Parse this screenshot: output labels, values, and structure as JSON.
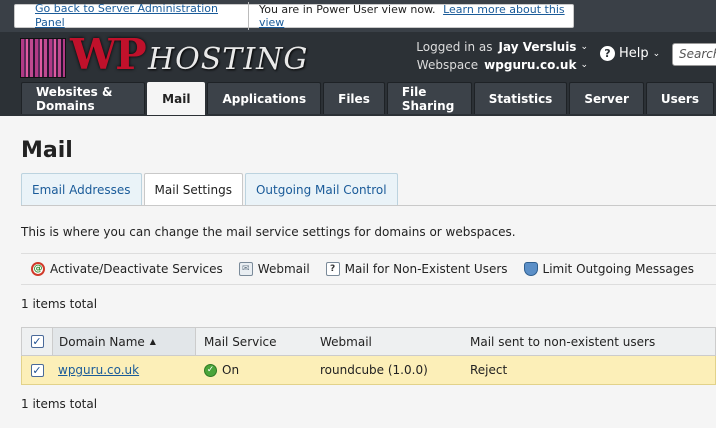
{
  "notice": {
    "back_link": "Go back to Server Administration Panel",
    "message": "You are in Power User view now.",
    "learn_link": "Learn more about this view"
  },
  "logo": {
    "wp": "WP",
    "hosting": "HOSTING"
  },
  "user": {
    "logged_in_label": "Logged in as",
    "logged_in_value": "Jay Versluis",
    "webspace_label": "Webspace",
    "webspace_value": "wpguru.co.uk"
  },
  "help_label": "Help",
  "search_placeholder": "Search",
  "nav": {
    "tabs": [
      {
        "label": "Websites & Domains"
      },
      {
        "label": "Mail"
      },
      {
        "label": "Applications"
      },
      {
        "label": "Files"
      },
      {
        "label": "File Sharing"
      },
      {
        "label": "Statistics"
      },
      {
        "label": "Server"
      },
      {
        "label": "Users"
      }
    ],
    "active": "Mail"
  },
  "page_title": "Mail",
  "subtabs": [
    {
      "label": "Email Addresses"
    },
    {
      "label": "Mail Settings"
    },
    {
      "label": "Outgoing Mail Control"
    }
  ],
  "description": "This is where you can change the mail service settings for domains or webspaces.",
  "toolbar": {
    "activate": "Activate/Deactivate Services",
    "webmail": "Webmail",
    "nonexistent": "Mail for Non-Existent Users",
    "limit": "Limit Outgoing Messages"
  },
  "items_total": "1 items total",
  "table": {
    "headers": {
      "domain": "Domain Name",
      "service": "Mail Service",
      "webmail": "Webmail",
      "nonexistent": "Mail sent to non-existent users"
    },
    "rows": [
      {
        "domain": "wpguru.co.uk",
        "service": "On",
        "webmail": "roundcube (1.0.0)",
        "nonexistent": "Reject"
      }
    ]
  },
  "colors": {
    "header_bg": "#2c3136",
    "link": "#1a5b99",
    "row_highlight": "#fcefb8",
    "logo_red": "#c0112b"
  }
}
